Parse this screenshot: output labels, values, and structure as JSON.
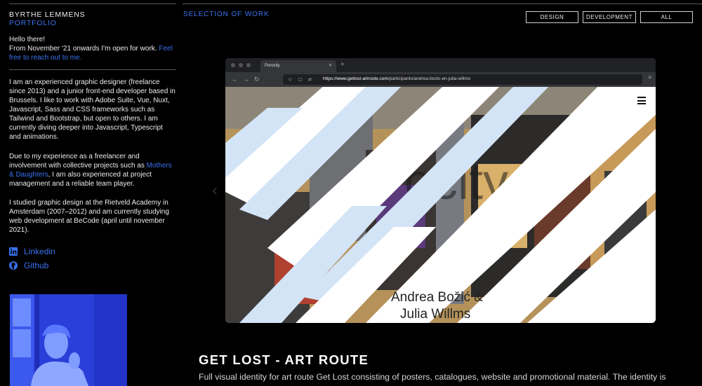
{
  "sidebar": {
    "name": "BYRTHE LEMMENS",
    "role": "PORTFOLIO",
    "intro_greeting": "Hello there!",
    "intro_text": "From November '21 onwards I'm open for work. ",
    "intro_link": "Feel free to reach out to me.",
    "para1": "I am an experienced graphic designer (freelance since 2013) and a junior front-end developer based in Brussels. I like to work with Adobe Suite, Vue, Nuxt, Javascript, Sass and CSS frameworks such as Tailwind and Bootstrap, but open to others. I am currently diving deeper into Javascript, Typescript and animations.",
    "para2_before": "Due to my experience as a freelancer and involvement with collective projects such as ",
    "para2_link": "Mothers & Daughters",
    "para2_after": ", I am also experienced at project management and a reliable team player.",
    "para3": "I studied graphic design at the Rietveld Academy in Amsterdam (2007–2012) and am currently studying web development at BeCode (april until november 2021).",
    "links": [
      {
        "label": "Linkedin",
        "icon": "linkedin-icon"
      },
      {
        "label": "Github",
        "icon": "github-icon"
      }
    ]
  },
  "main": {
    "section_title": "SELECTION OF WORK",
    "filters": [
      "DESIGN",
      "DEVELOPMENT",
      "ALL"
    ],
    "browser": {
      "tab_title": "Porocity",
      "url_host": "https://www.getlost-artroute.com",
      "url_path": "/participants/andrea-bozic-en-julia-willms"
    },
    "slide_caption_line1": "Andrea Božić &",
    "slide_caption_line2": "Julia Willms",
    "project_title": "GET LOST - ART ROUTE",
    "project_desc": "Full visual identity for art route Get Lost consisting of posters, catalogues, website and promotional material. The identity is"
  },
  "colors": {
    "accent": "#3a72f0",
    "background": "#000000",
    "text": "#ececec"
  }
}
